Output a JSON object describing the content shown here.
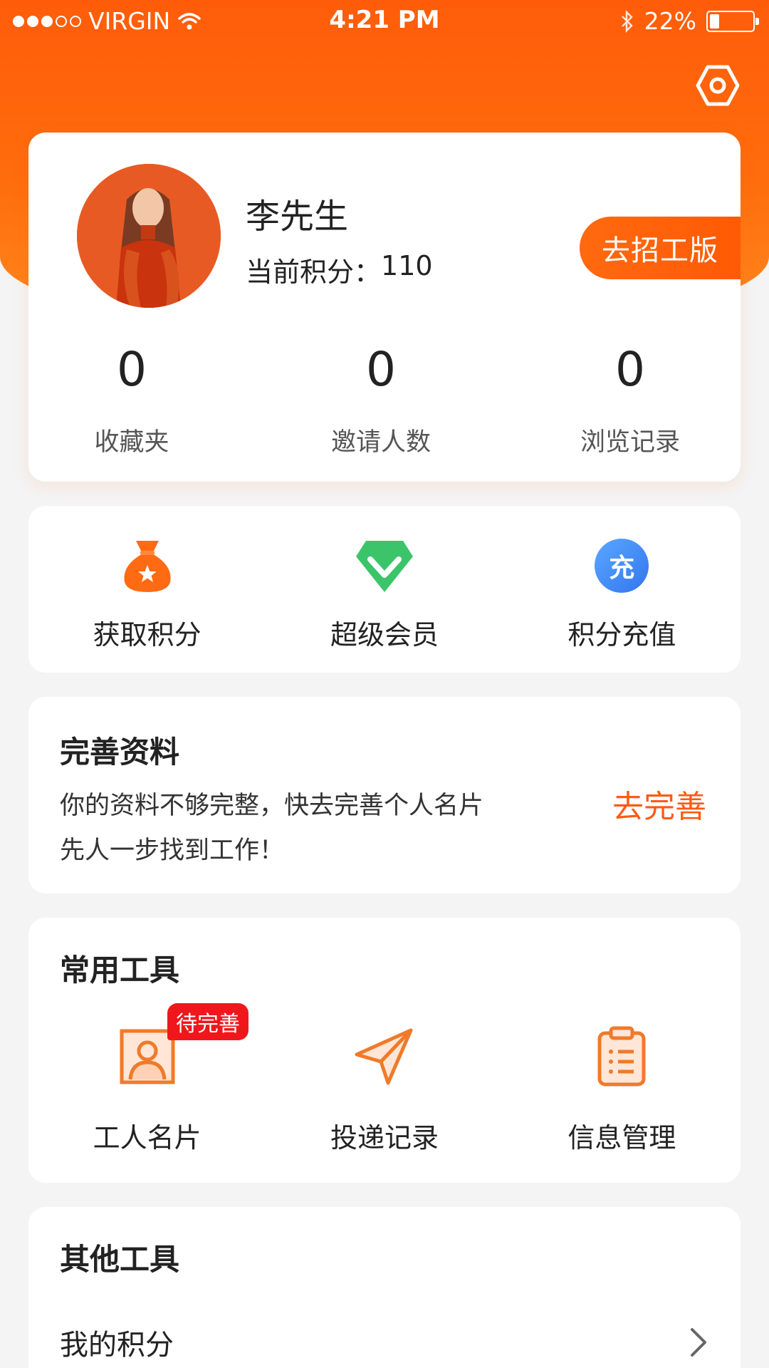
{
  "status_bar": {
    "carrier": "VIRGIN",
    "time": "4:21 PM",
    "battery": "22%",
    "battery_level": 0.22,
    "icons": [
      "signal-dots-icon",
      "wifi-icon",
      "bluetooth-icon",
      "battery-icon"
    ]
  },
  "header": {
    "settings_icon": "hexagon-settings-icon",
    "accent_color": "#ff5c0a"
  },
  "profile": {
    "name": "李先生",
    "points_label": "当前积分：",
    "points_value": "110",
    "recruit_button": "去招工版",
    "stats": [
      {
        "value": "0",
        "label": "收藏夹"
      },
      {
        "value": "0",
        "label": "邀请人数"
      },
      {
        "value": "0",
        "label": "浏览记录"
      }
    ]
  },
  "quick_actions": [
    {
      "label": "获取积分",
      "icon": "money-bag-star-icon",
      "color": "#ff6a13"
    },
    {
      "label": "超级会员",
      "icon": "green-gem-check-icon",
      "color": "#3cc46a"
    },
    {
      "label": "积分充值",
      "icon": "recharge-circle-icon",
      "color": "#3d86f5",
      "icon_text": "充"
    }
  ],
  "profile_tip": {
    "title": "完善资料",
    "line1": "你的资料不够完整，快去完善个人名片",
    "line2": "先人一步找到工作！",
    "action": "去完善"
  },
  "common_tools": {
    "title": "常用工具",
    "items": [
      {
        "label": "工人名片",
        "icon": "worker-card-icon",
        "badge": "待完善"
      },
      {
        "label": "投递记录",
        "icon": "paper-plane-icon"
      },
      {
        "label": "信息管理",
        "icon": "clipboard-list-icon"
      }
    ]
  },
  "other_tools": {
    "title": "其他工具",
    "items": [
      {
        "label": "我的积分",
        "icon": "chevron-right-icon"
      }
    ]
  }
}
